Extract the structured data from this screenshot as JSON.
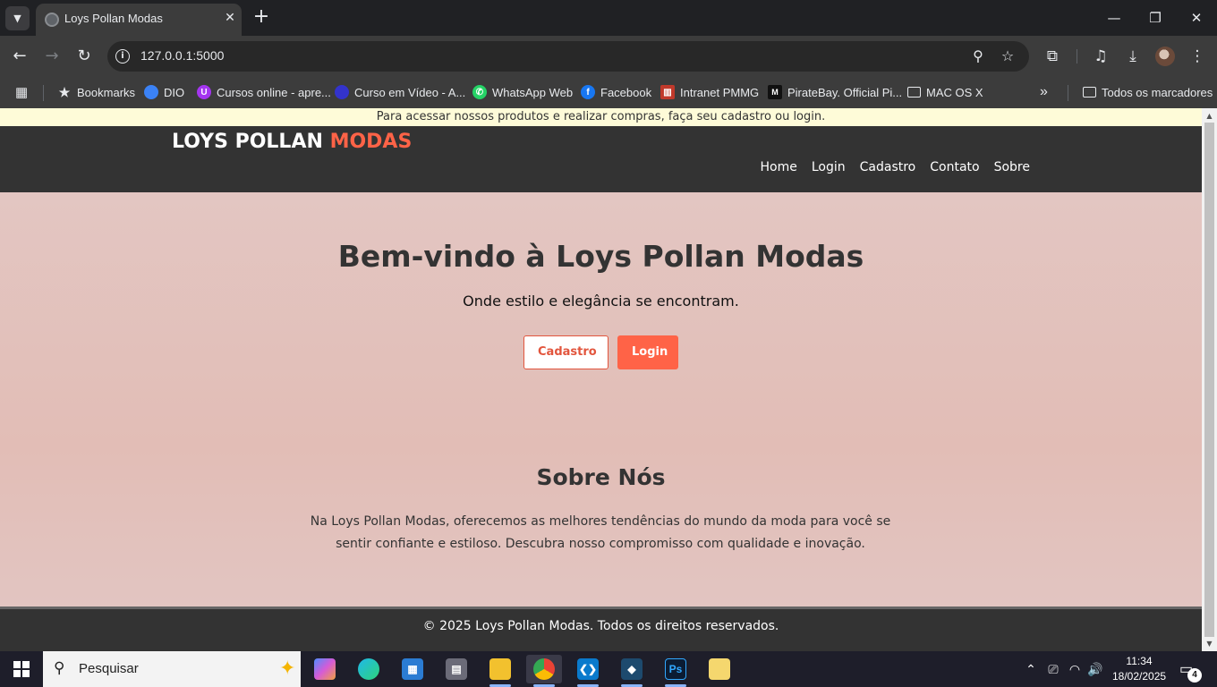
{
  "browser": {
    "tab_title": "Loys Pollan Modas",
    "url": "127.0.0.1:5000",
    "bookmarks": [
      {
        "label": "Bookmarks",
        "icon": "star-icon",
        "color": "#e8eaed"
      },
      {
        "label": "DIO",
        "icon": "dio-icon",
        "color": "#3b82f6"
      },
      {
        "label": "Cursos online - apre...",
        "icon": "udemy-icon",
        "color": "#a435f0"
      },
      {
        "label": "Curso em Vídeo - A...",
        "icon": "cursoemvideo-icon",
        "color": "#3333cc"
      },
      {
        "label": "WhatsApp Web",
        "icon": "whatsapp-icon",
        "color": "#25d366"
      },
      {
        "label": "Facebook",
        "icon": "facebook-icon",
        "color": "#1877f2"
      },
      {
        "label": "Intranet PMMG",
        "icon": "pmmg-icon",
        "color": "#c0392b"
      },
      {
        "label": "PirateBay. Official Pi...",
        "icon": "piratebay-icon",
        "color": "#111111"
      },
      {
        "label": "MAC OS X",
        "icon": "folder-icon",
        "color": "#e8eaed"
      }
    ],
    "all_bookmarks": "Todos os marcadores"
  },
  "site": {
    "notice": "Para acessar nossos produtos e realizar compras, faça seu cadastro ou login.",
    "logo_main": "LOYS POLLAN ",
    "logo_accent": "MODAS",
    "nav": [
      "Home",
      "Login",
      "Cadastro",
      "Contato",
      "Sobre"
    ],
    "hero": {
      "title": "Bem-vindo à Loys Pollan Modas",
      "subtitle": "Onde estilo e elegância se encontram.",
      "btn_signup": "Cadastro",
      "btn_login": "Login"
    },
    "about": {
      "title": "Sobre Nós",
      "text": "Na Loys Pollan Modas, oferecemos as melhores tendências do mundo da moda para você se sentir confiante e estiloso. Descubra nosso compromisso com qualidade e inovação."
    },
    "footer": "© 2025 Loys Pollan Modas. Todos os direitos reservados.",
    "accent_color": "#ff6347"
  },
  "taskbar": {
    "search_placeholder": "Pesquisar",
    "time": "11:34",
    "date": "18/02/2025",
    "notification_count": "4"
  }
}
